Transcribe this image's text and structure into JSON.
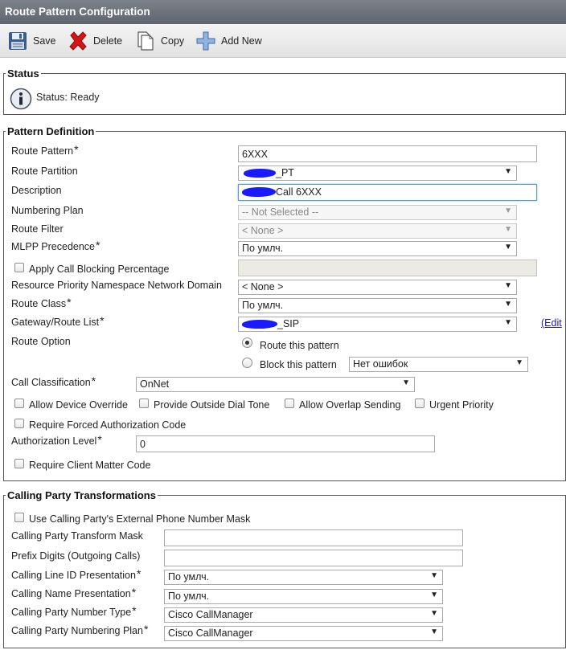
{
  "title": "Route Pattern Configuration",
  "toolbar": {
    "save": "Save",
    "delete": "Delete",
    "copy": "Copy",
    "add_new": "Add New"
  },
  "status": {
    "legend": "Status",
    "text": "Status: Ready"
  },
  "pattern_definition": {
    "legend": "Pattern Definition",
    "route_pattern": {
      "label": "Route Pattern",
      "value": "6XXX"
    },
    "route_partition": {
      "label": "Route Partition",
      "value": "_PT"
    },
    "description": {
      "label": "Description",
      "value": "Call 6XXX"
    },
    "numbering_plan": {
      "label": "Numbering Plan",
      "value": "-- Not Selected --"
    },
    "route_filter": {
      "label": "Route Filter",
      "value": "< None >"
    },
    "mlpp_precedence": {
      "label": "MLPP Precedence",
      "value": "По умлч."
    },
    "apply_call_blocking": {
      "label": "Apply Call Blocking Percentage"
    },
    "resource_priority": {
      "label": "Resource Priority Namespace Network Domain",
      "value": "< None >"
    },
    "route_class": {
      "label": "Route Class",
      "value": "По умлч."
    },
    "gateway_route_list": {
      "label": "Gateway/Route List",
      "value": "_SIP",
      "edit_link": "(Edit"
    },
    "route_option": {
      "label": "Route Option",
      "route_this_pattern": "Route this pattern",
      "block_this_pattern": "Block this pattern",
      "block_reason": "Нет ошибок"
    },
    "call_classification": {
      "label": "Call Classification",
      "value": "OnNet"
    },
    "allow_device_override": "Allow Device Override",
    "provide_outside_dial_tone": "Provide Outside Dial Tone",
    "allow_overlap_sending": "Allow Overlap Sending",
    "urgent_priority": "Urgent Priority",
    "require_forced_auth": "Require Forced Authorization Code",
    "authorization_level": {
      "label": "Authorization Level",
      "value": "0"
    },
    "require_client_matter": "Require Client Matter Code"
  },
  "calling_party": {
    "legend": "Calling Party Transformations",
    "use_external_mask": "Use Calling Party's External Phone Number Mask",
    "transform_mask": {
      "label": "Calling Party Transform Mask",
      "value": ""
    },
    "prefix_digits": {
      "label": "Prefix Digits (Outgoing Calls)",
      "value": ""
    },
    "calling_line_id": {
      "label": "Calling Line ID Presentation",
      "value": "По умлч."
    },
    "calling_name": {
      "label": "Calling Name Presentation",
      "value": "По умлч."
    },
    "number_type": {
      "label": "Calling Party Number Type",
      "value": "Cisco CallManager"
    },
    "numbering_plan": {
      "label": "Calling Party Numbering Plan",
      "value": "Cisco CallManager"
    }
  },
  "required_mark": "*",
  "icons": {
    "save": "floppy-disk-icon",
    "delete": "red-x-icon",
    "copy": "document-copy-icon",
    "add_new": "plus-icon",
    "status": "info-icon"
  },
  "colors": {
    "titlebar": "#6e737b",
    "toolbar": "#ececec",
    "redaction": "#1a1aff",
    "link": "#1a1aa8"
  }
}
